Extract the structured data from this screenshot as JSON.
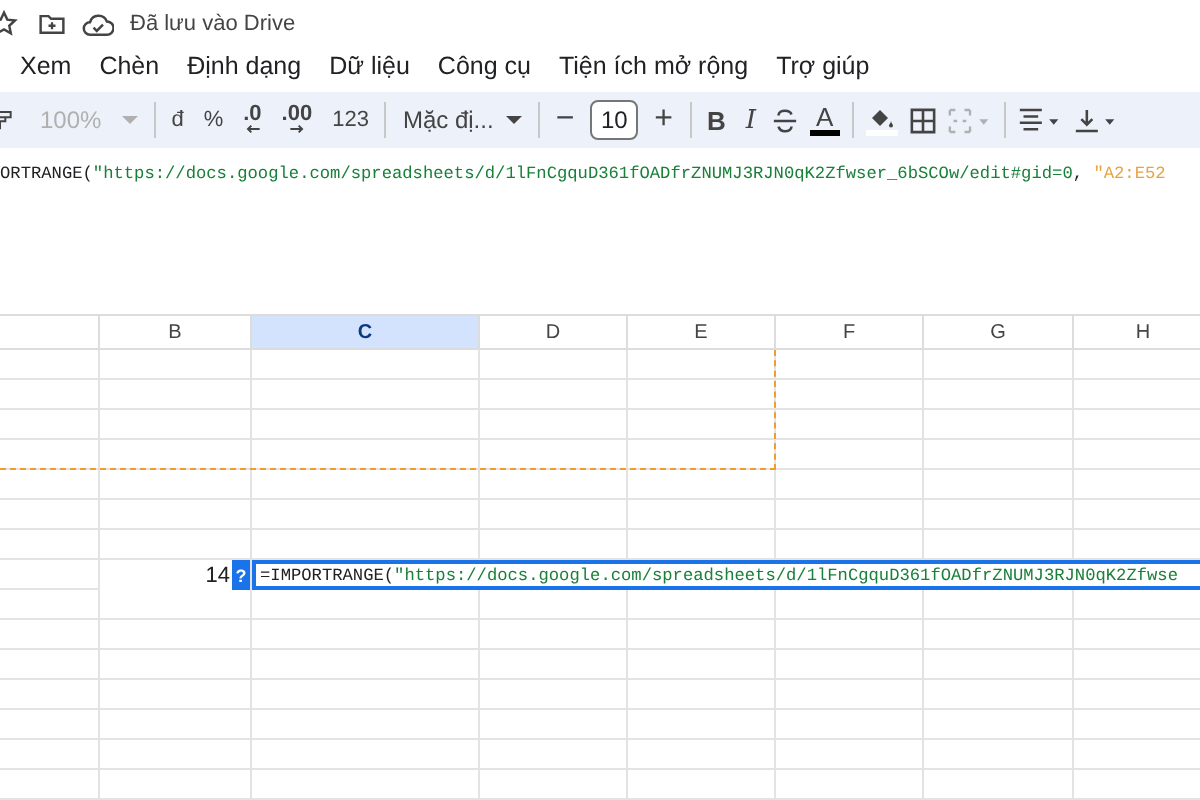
{
  "header": {
    "save_status": "Đã lưu vào Drive"
  },
  "menu": [
    {
      "label": "Xem"
    },
    {
      "label": "Chèn"
    },
    {
      "label": "Định dạng"
    },
    {
      "label": "Dữ liệu"
    },
    {
      "label": "Công cụ"
    },
    {
      "label": "Tiện ích mở rộng"
    },
    {
      "label": "Trợ giúp"
    }
  ],
  "toolbar": {
    "groups": [
      [
        {
          "kind": "paint-format",
          "disabled": false
        },
        {
          "kind": "zoom",
          "label": "100%",
          "disabled": true
        }
      ],
      [
        {
          "kind": "text",
          "label": "đ",
          "disabled": false
        },
        {
          "kind": "text",
          "label": "%",
          "disabled": false
        },
        {
          "kind": "decimal-decrease",
          "label": ".0",
          "disabled": false
        },
        {
          "kind": "decimal-increase",
          "label": ".00",
          "disabled": false
        },
        {
          "kind": "text",
          "label": "123",
          "disabled": false
        }
      ],
      [
        {
          "kind": "font",
          "label": "Mặc đị...",
          "disabled": false
        }
      ],
      [
        {
          "kind": "step",
          "label": "−",
          "disabled": false
        },
        {
          "kind": "size",
          "label": "10",
          "disabled": false
        },
        {
          "kind": "step",
          "label": "+",
          "disabled": false
        }
      ],
      [
        {
          "kind": "bold",
          "label": "B",
          "disabled": false
        },
        {
          "kind": "italic",
          "label": "I",
          "disabled": false
        },
        {
          "kind": "strike",
          "disabled": false
        },
        {
          "kind": "text-color",
          "label": "A",
          "disabled": false
        }
      ],
      [
        {
          "kind": "fill",
          "disabled": false
        },
        {
          "kind": "borders",
          "disabled": false
        },
        {
          "kind": "merge",
          "disabled": true
        }
      ],
      [
        {
          "kind": "align",
          "disabled": false
        },
        {
          "kind": "valign",
          "disabled": false
        }
      ]
    ]
  },
  "formula_bar": {
    "segments": [
      {
        "kind": "function",
        "text": "ORTRANGE("
      },
      {
        "kind": "string",
        "text": "\"https://docs.google.com/spreadsheets/d/1lFnCgquD361fOADfrZNUMJ3RJN0qK2Zfwser_6bSCOw/edit#gid=0"
      },
      {
        "kind": "function",
        "text": ", "
      },
      {
        "kind": "range",
        "text": "\"A2:E52"
      }
    ]
  },
  "grid": {
    "columns": [
      {
        "selected": false
      },
      {
        "label": "B",
        "selected": false
      },
      {
        "label": "C",
        "selected": true
      },
      {
        "label": "D",
        "selected": false
      },
      {
        "label": "E",
        "selected": false
      },
      {
        "label": "F",
        "selected": false
      },
      {
        "label": "G",
        "selected": false
      },
      {
        "label": "H",
        "selected": false
      }
    ],
    "value_cell": {
      "text": "14"
    },
    "help_badge": "?",
    "cell_editor": {
      "segments": [
        {
          "kind": "function",
          "text": "=IMPORTRANGE("
        },
        {
          "kind": "string",
          "text": "\"https://docs.google.com/spreadsheets/d/1lFnCgquD361fOADfrZNUMJ3RJN0qK2Zfwse"
        }
      ]
    }
  }
}
